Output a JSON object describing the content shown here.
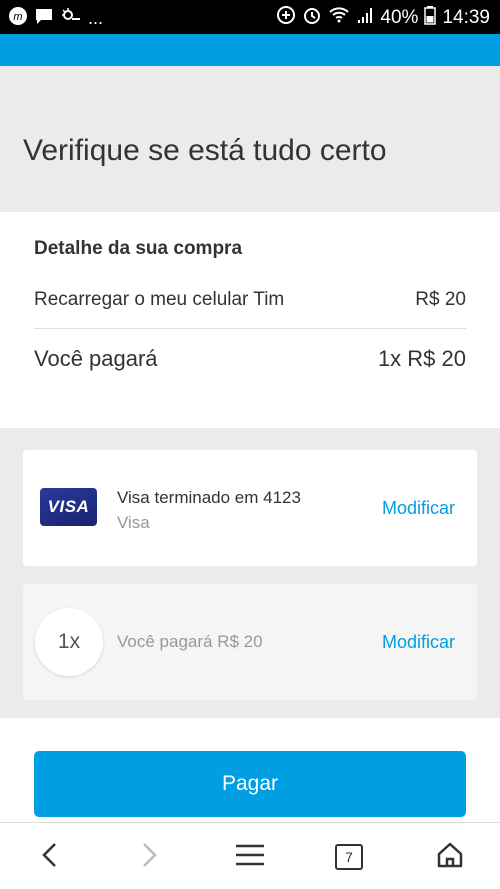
{
  "statusbar": {
    "battery": "40%",
    "time": "14:39",
    "notification_more": "..."
  },
  "header": {
    "title": "Verifique se está tudo certo"
  },
  "detail": {
    "title": "Detalhe da sua compra",
    "item_label": "Recarregar o meu celular Tim",
    "item_value": "R$ 20",
    "total_label": "Você pagará",
    "total_value": "1x R$ 20"
  },
  "payment_method": {
    "brand_logo": "VISA",
    "title": "Visa terminado em 4123",
    "subtitle": "Visa",
    "modify_label": "Modificar"
  },
  "installments": {
    "count": "1x",
    "text": "Você pagará R$ 20",
    "modify_label": "Modificar"
  },
  "actions": {
    "pay_label": "Pagar"
  },
  "navbar": {
    "tab_count": "7"
  },
  "colors": {
    "accent": "#009ee3",
    "background": "#ebebeb",
    "text": "#333333"
  }
}
